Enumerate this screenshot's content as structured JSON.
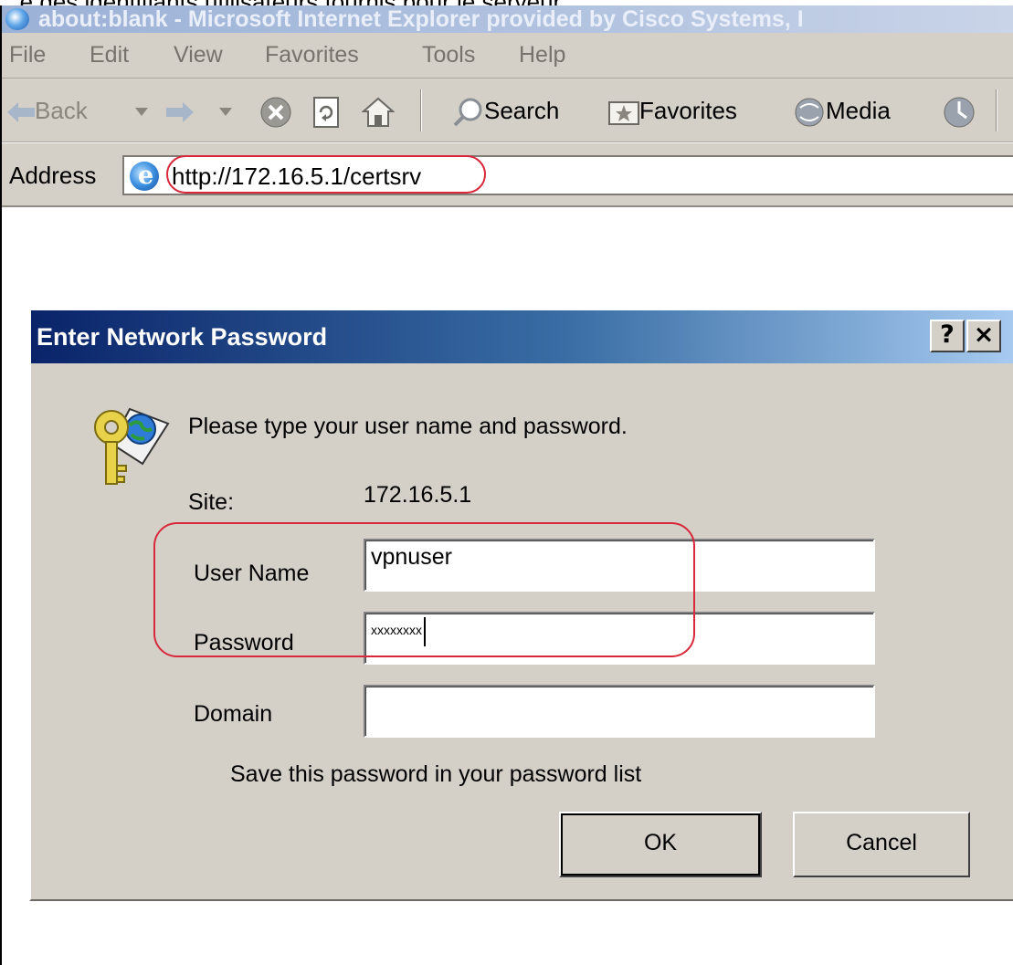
{
  "caption": "...e des identifiants utilisateurs fournis pour le serveur",
  "window": {
    "title": "about:blank - Microsoft Internet Explorer provided by Cisco Systems, I"
  },
  "menu": [
    "File",
    "Edit",
    "View",
    "Favorites",
    "Tools",
    "Help"
  ],
  "toolbar": {
    "back_label": "Back",
    "search_label": "Search",
    "favorites_label": "Favorites",
    "media_label": "Media"
  },
  "address": {
    "label": "Address",
    "url": "http://172.16.5.1/certsrv"
  },
  "dialog": {
    "title": "Enter Network Password",
    "help_glyph": "?",
    "close_glyph": "×",
    "prompt": "Please type your user name and password.",
    "site_label": "Site:",
    "site_value": "172.16.5.1",
    "username_label": "User Name",
    "username_value": "vpnuser",
    "password_label": "Password",
    "password_value": "xxxxxxxx",
    "domain_label": "Domain",
    "domain_value": "",
    "save_password_label": "Save this password in your password list",
    "save_password_checked": false,
    "ok_label": "OK",
    "cancel_label": "Cancel"
  },
  "colors": {
    "titlebar_active": "#0a246a",
    "highlight_annotation": "#d8283a",
    "dialog_face": "#d4d0c8"
  }
}
